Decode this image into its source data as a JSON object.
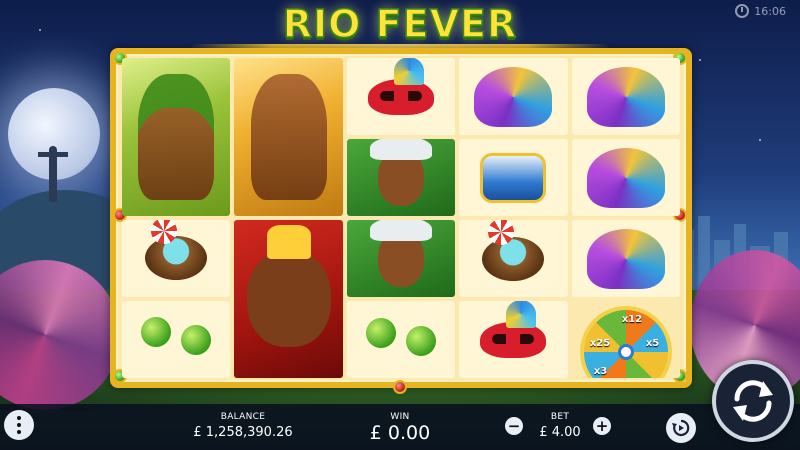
{
  "game": {
    "title": "RIO FEVER"
  },
  "status": {
    "clock_icon": "clock-icon",
    "time": "16:06"
  },
  "reels": [
    [
      "dancer-green-top",
      "cocktail-coconut",
      "maracas"
    ],
    [
      "dancer-gold-top",
      "dancer-red-headdress"
    ],
    [
      "carnival-mask",
      "dancer-portrait-white-feathers",
      "dancer-portrait-white-feathers",
      "maracas"
    ],
    [
      "feather-headdress",
      "drum",
      "cocktail-coconut",
      "carnival-mask"
    ],
    [
      "feather-headdress",
      "feather-headdress",
      "feather-headdress",
      "bonus-wheel"
    ]
  ],
  "bonus_wheel": {
    "labels": [
      "x12",
      "x25",
      "x5",
      "x3"
    ]
  },
  "bottom_bar": {
    "menu_icon": "more-vertical-icon",
    "balance_label": "BALANCE",
    "balance_value": "£ 1,258,390.26",
    "win_label": "WIN",
    "win_value": "£ 0.00",
    "bet_label": "BET",
    "bet_value": "£ 4.00",
    "bet_decrease": "−",
    "bet_increase": "+",
    "autoplay_icon": "autoplay-icon",
    "spin_icon": "spin-icon"
  },
  "colors": {
    "title_fill": "#ffe33a",
    "title_outline": "#3a8a12",
    "frame_gold": "#e8b321",
    "bar_bg": "#080e1e"
  }
}
